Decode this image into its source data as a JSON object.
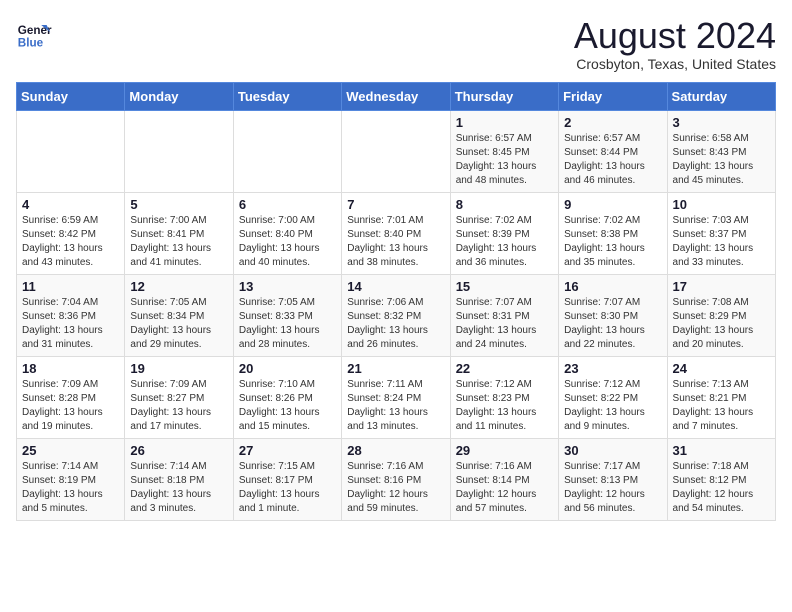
{
  "header": {
    "logo_line1": "General",
    "logo_line2": "Blue",
    "month_title": "August 2024",
    "subtitle": "Crosbyton, Texas, United States"
  },
  "weekdays": [
    "Sunday",
    "Monday",
    "Tuesday",
    "Wednesday",
    "Thursday",
    "Friday",
    "Saturday"
  ],
  "weeks": [
    [
      {
        "day": "",
        "info": ""
      },
      {
        "day": "",
        "info": ""
      },
      {
        "day": "",
        "info": ""
      },
      {
        "day": "",
        "info": ""
      },
      {
        "day": "1",
        "info": "Sunrise: 6:57 AM\nSunset: 8:45 PM\nDaylight: 13 hours\nand 48 minutes."
      },
      {
        "day": "2",
        "info": "Sunrise: 6:57 AM\nSunset: 8:44 PM\nDaylight: 13 hours\nand 46 minutes."
      },
      {
        "day": "3",
        "info": "Sunrise: 6:58 AM\nSunset: 8:43 PM\nDaylight: 13 hours\nand 45 minutes."
      }
    ],
    [
      {
        "day": "4",
        "info": "Sunrise: 6:59 AM\nSunset: 8:42 PM\nDaylight: 13 hours\nand 43 minutes."
      },
      {
        "day": "5",
        "info": "Sunrise: 7:00 AM\nSunset: 8:41 PM\nDaylight: 13 hours\nand 41 minutes."
      },
      {
        "day": "6",
        "info": "Sunrise: 7:00 AM\nSunset: 8:40 PM\nDaylight: 13 hours\nand 40 minutes."
      },
      {
        "day": "7",
        "info": "Sunrise: 7:01 AM\nSunset: 8:40 PM\nDaylight: 13 hours\nand 38 minutes."
      },
      {
        "day": "8",
        "info": "Sunrise: 7:02 AM\nSunset: 8:39 PM\nDaylight: 13 hours\nand 36 minutes."
      },
      {
        "day": "9",
        "info": "Sunrise: 7:02 AM\nSunset: 8:38 PM\nDaylight: 13 hours\nand 35 minutes."
      },
      {
        "day": "10",
        "info": "Sunrise: 7:03 AM\nSunset: 8:37 PM\nDaylight: 13 hours\nand 33 minutes."
      }
    ],
    [
      {
        "day": "11",
        "info": "Sunrise: 7:04 AM\nSunset: 8:36 PM\nDaylight: 13 hours\nand 31 minutes."
      },
      {
        "day": "12",
        "info": "Sunrise: 7:05 AM\nSunset: 8:34 PM\nDaylight: 13 hours\nand 29 minutes."
      },
      {
        "day": "13",
        "info": "Sunrise: 7:05 AM\nSunset: 8:33 PM\nDaylight: 13 hours\nand 28 minutes."
      },
      {
        "day": "14",
        "info": "Sunrise: 7:06 AM\nSunset: 8:32 PM\nDaylight: 13 hours\nand 26 minutes."
      },
      {
        "day": "15",
        "info": "Sunrise: 7:07 AM\nSunset: 8:31 PM\nDaylight: 13 hours\nand 24 minutes."
      },
      {
        "day": "16",
        "info": "Sunrise: 7:07 AM\nSunset: 8:30 PM\nDaylight: 13 hours\nand 22 minutes."
      },
      {
        "day": "17",
        "info": "Sunrise: 7:08 AM\nSunset: 8:29 PM\nDaylight: 13 hours\nand 20 minutes."
      }
    ],
    [
      {
        "day": "18",
        "info": "Sunrise: 7:09 AM\nSunset: 8:28 PM\nDaylight: 13 hours\nand 19 minutes."
      },
      {
        "day": "19",
        "info": "Sunrise: 7:09 AM\nSunset: 8:27 PM\nDaylight: 13 hours\nand 17 minutes."
      },
      {
        "day": "20",
        "info": "Sunrise: 7:10 AM\nSunset: 8:26 PM\nDaylight: 13 hours\nand 15 minutes."
      },
      {
        "day": "21",
        "info": "Sunrise: 7:11 AM\nSunset: 8:24 PM\nDaylight: 13 hours\nand 13 minutes."
      },
      {
        "day": "22",
        "info": "Sunrise: 7:12 AM\nSunset: 8:23 PM\nDaylight: 13 hours\nand 11 minutes."
      },
      {
        "day": "23",
        "info": "Sunrise: 7:12 AM\nSunset: 8:22 PM\nDaylight: 13 hours\nand 9 minutes."
      },
      {
        "day": "24",
        "info": "Sunrise: 7:13 AM\nSunset: 8:21 PM\nDaylight: 13 hours\nand 7 minutes."
      }
    ],
    [
      {
        "day": "25",
        "info": "Sunrise: 7:14 AM\nSunset: 8:19 PM\nDaylight: 13 hours\nand 5 minutes."
      },
      {
        "day": "26",
        "info": "Sunrise: 7:14 AM\nSunset: 8:18 PM\nDaylight: 13 hours\nand 3 minutes."
      },
      {
        "day": "27",
        "info": "Sunrise: 7:15 AM\nSunset: 8:17 PM\nDaylight: 13 hours\nand 1 minute."
      },
      {
        "day": "28",
        "info": "Sunrise: 7:16 AM\nSunset: 8:16 PM\nDaylight: 12 hours\nand 59 minutes."
      },
      {
        "day": "29",
        "info": "Sunrise: 7:16 AM\nSunset: 8:14 PM\nDaylight: 12 hours\nand 57 minutes."
      },
      {
        "day": "30",
        "info": "Sunrise: 7:17 AM\nSunset: 8:13 PM\nDaylight: 12 hours\nand 56 minutes."
      },
      {
        "day": "31",
        "info": "Sunrise: 7:18 AM\nSunset: 8:12 PM\nDaylight: 12 hours\nand 54 minutes."
      }
    ]
  ]
}
